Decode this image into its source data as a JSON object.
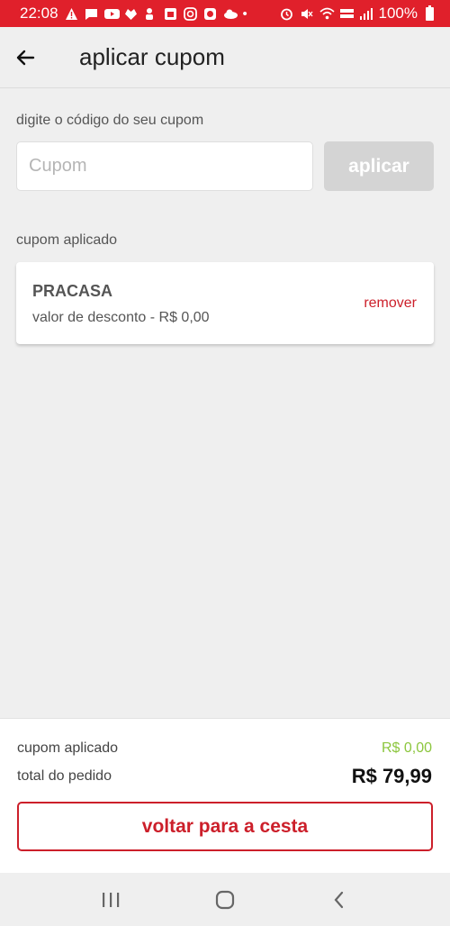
{
  "status_bar": {
    "time": "22:08",
    "battery": "100%",
    "notification_icons": [
      "warning-icon",
      "message-icon",
      "youtube-icon",
      "gift-icon",
      "notification-icon",
      "calendar-icon",
      "instagram-icon",
      "chat-icon",
      "cloud-icon",
      "dot-icon"
    ],
    "system_icons": [
      "alarm-icon",
      "mute-icon",
      "wifi-icon",
      "volte-icon",
      "signal-icon",
      "battery-icon"
    ],
    "color": "#e0202b"
  },
  "app_bar": {
    "title": "aplicar cupom",
    "back_icon": "arrow-left-icon"
  },
  "coupon_entry": {
    "label": "digite o código do seu cupom",
    "placeholder": "Cupom",
    "value": "",
    "apply_label": "aplicar"
  },
  "applied": {
    "label": "cupom aplicado",
    "code": "PRACASA",
    "discount_text": "valor de desconto - R$ 0,00",
    "remove_label": "remover"
  },
  "summary": {
    "coupon_label": "cupom aplicado",
    "coupon_value": "R$ 0,00",
    "total_label": "total do pedido",
    "total_value": "R$ 79,99",
    "back_button_label": "voltar para a cesta"
  },
  "colors": {
    "accent": "#cc1f2a",
    "discount_green": "#8cc63e",
    "disabled_button": "#d4d4d4"
  },
  "nav_bar": {
    "buttons": [
      "recents-icon",
      "home-icon",
      "back-icon"
    ]
  }
}
